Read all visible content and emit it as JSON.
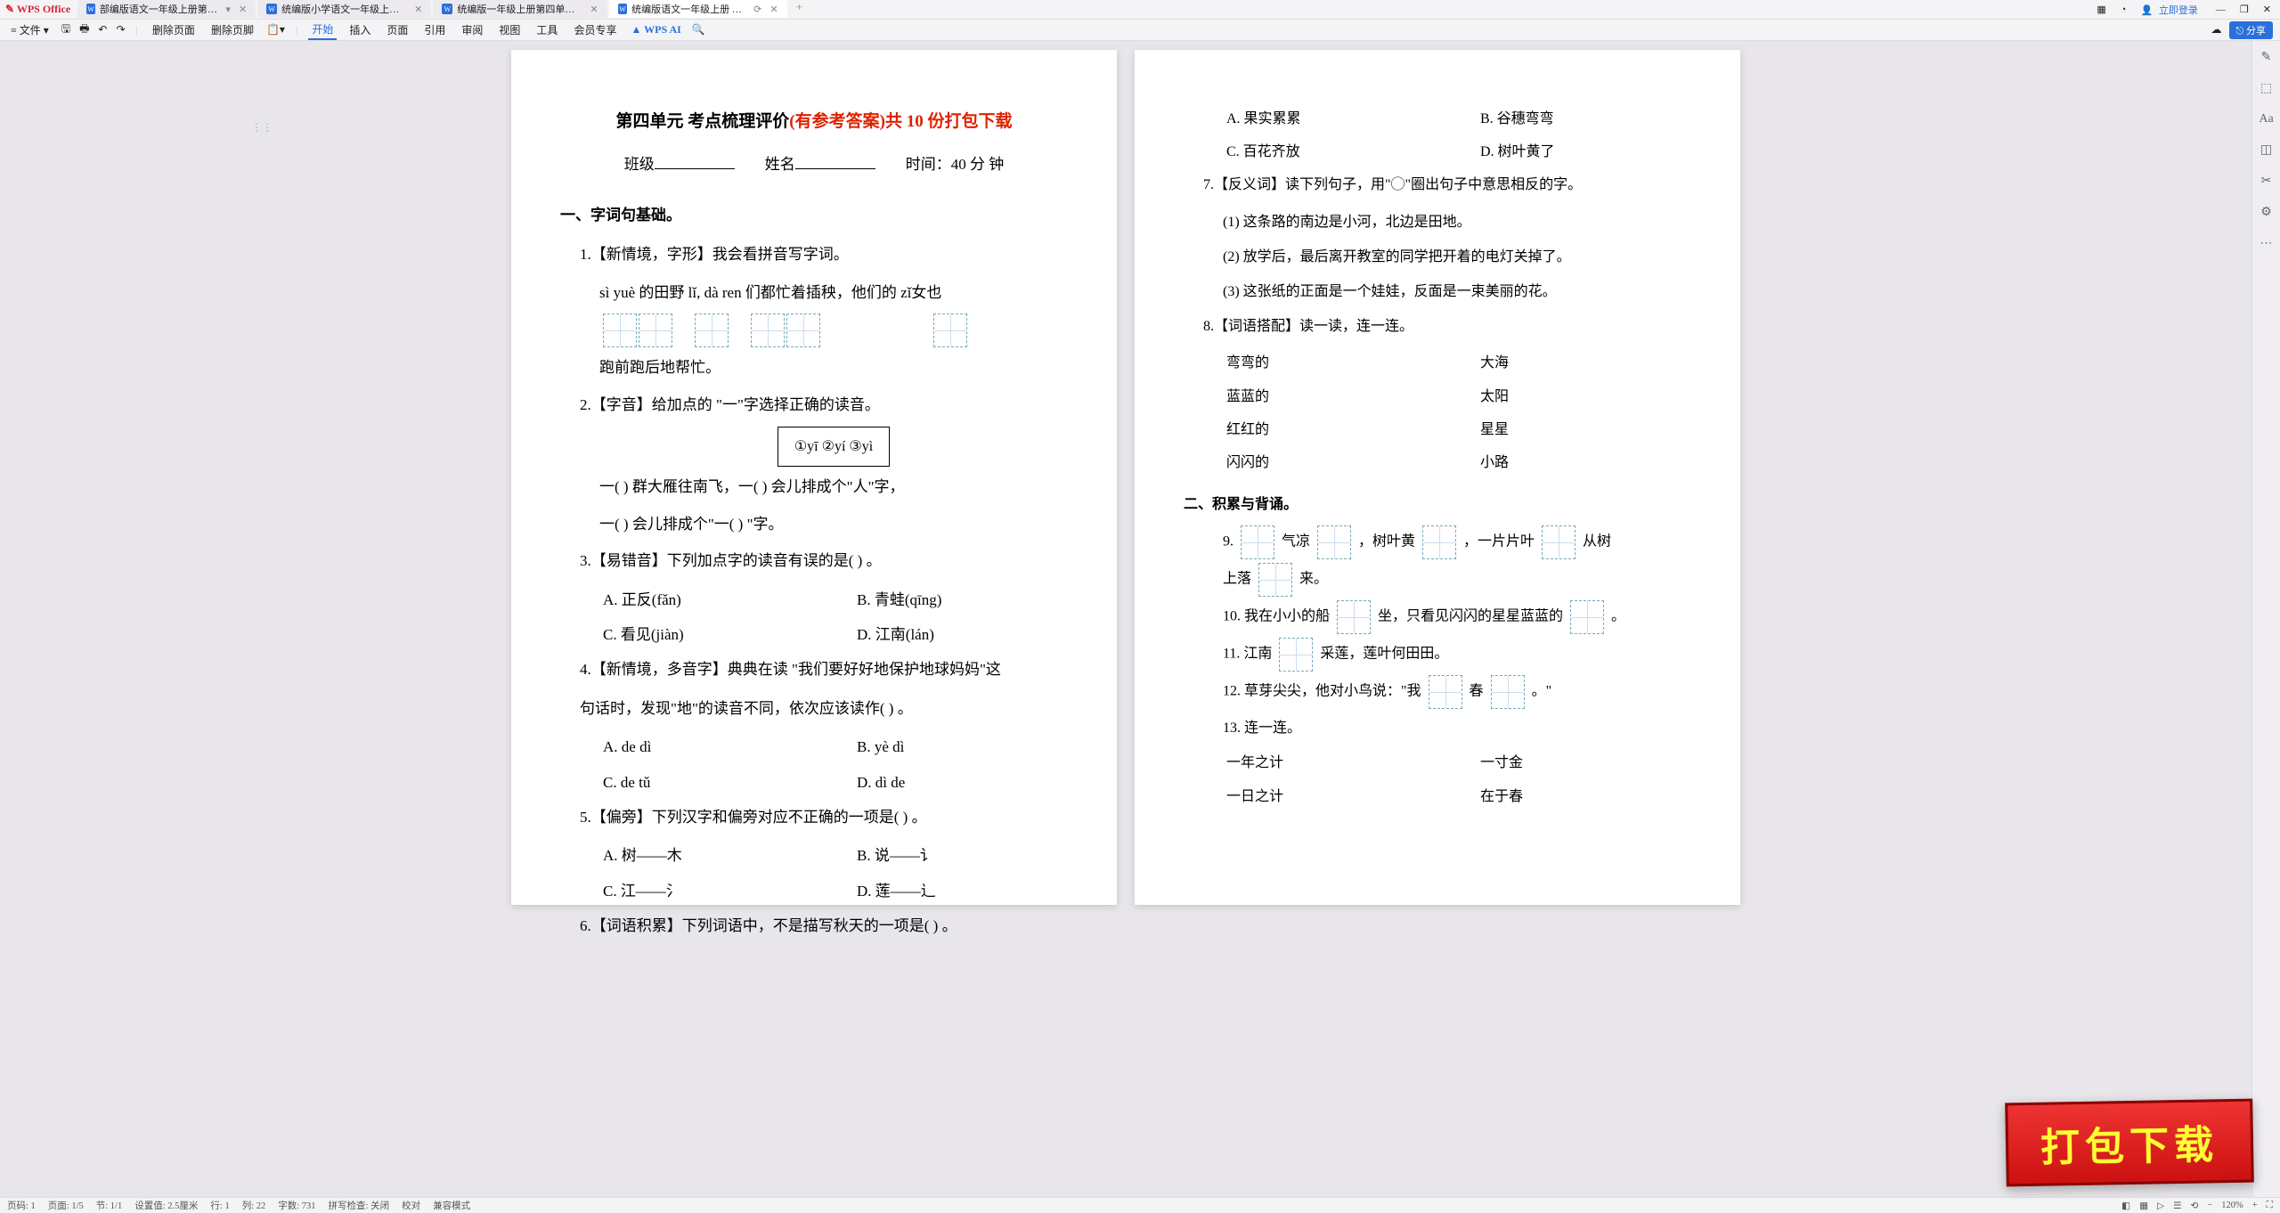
{
  "app": "WPS Office",
  "tabs": [
    {
      "label": "部编版语文一年级上册第四单元综"
    },
    {
      "label": "统编版小学语文一年级上册第四单元"
    },
    {
      "label": "统编版一年级上册第四单元试卷(含答"
    },
    {
      "label": "统编版语文一年级上册 第四年"
    }
  ],
  "window": {
    "login": "立即登录"
  },
  "toolbar": {
    "file": "文件",
    "delpage": "删除页面",
    "delpgft": "删除页脚",
    "menus": [
      "开始",
      "插入",
      "页面",
      "引用",
      "审阅",
      "视图",
      "工具",
      "会员专享"
    ],
    "ai": "WPS AI",
    "share": "分享"
  },
  "page1": {
    "title_a": "第四单元  考点梳理评价",
    "title_b": "(有参考答案)共 10 份打包下载",
    "info_class": "班级",
    "info_name": "姓名",
    "info_time": "时间：",
    "info_time_v": "40 分 钟",
    "s1": "一、字词句基础。",
    "q1": "1.【新情境，字形】我会看拼音写字词。",
    "q1_line": "sì   yuè 的田野 lǐ,     dà ren  们都忙着插秧，他们的 zǐ女也",
    "q1_tail": "跑前跑后地帮忙。",
    "q2": "2.【字音】给加点的 \"一\"字选择正确的读音。",
    "q2_box": "①yī   ②yí   ③yì",
    "q2_line1": "一(       )  群大雁往南飞，一(       )  会儿排成个\"人\"字，",
    "q2_line2": "一(       )  会儿排成个\"一(       ) \"字。",
    "q3": "3.【易错音】下列加点字的读音有误的是(       ) 。",
    "q3a": "A. 正反(fǎn)",
    "q3b": "B. 青蛙(qīng)",
    "q3c": "C. 看见(jiàn)",
    "q3d": "D. 江南(lán)",
    "q4": "4.【新情境，多音字】典典在读 \"我们要好好地保护地球妈妈\"这",
    "q4b": "句话时，发现\"地\"的读音不同，依次应该读作(       ) 。",
    "q4a1": "A. de   dì",
    "q4b1": "B. yè   dì",
    "q4c1": "C. de   tǔ",
    "q4d1": "D. dì   de",
    "q5": "5.【偏旁】下列汉字和偏旁对应不正确的一项是(       ) 。",
    "q5a": "A. 树——木",
    "q5b": "B. 说——讠",
    "q5c": "C. 江——氵",
    "q5d": "D. 莲——辶",
    "q6": "6.【词语积累】下列词语中，不是描写秋天的一项是(       ) 。"
  },
  "page2": {
    "optA": "A. 果实累累",
    "optB": "B. 谷穗弯弯",
    "optC": "C. 百花齐放",
    "optD": "D. 树叶黄了",
    "q7": "7.【反义词】读下列句子，用\"◯\"圈出句子中意思相反的字。",
    "q7_1": "(1) 这条路的南边是小河，北边是田地。",
    "q7_2": "(2) 放学后，最后离开教室的同学把开着的电灯关掉了。",
    "q7_3": "(3) 这张纸的正面是一个娃娃，反面是一束美丽的花。",
    "q8": "8.【词语搭配】读一读，连一连。",
    "q8l": [
      "弯弯的",
      "蓝蓝的",
      "红红的",
      "闪闪的"
    ],
    "q8r": [
      "大海",
      "太阳",
      "星星",
      "小路"
    ],
    "s2": "二、积累与背诵。",
    "q9a": "9.",
    "q9b": "气凉",
    "q9c": "，树叶黄",
    "q9d": "，一片片叶",
    "q9e": "从树",
    "q9f": "上落",
    "q9g": "来。",
    "q10a": "10. 我在小小的船",
    "q10b": "坐，只看见闪闪的星星蓝蓝的",
    "q10c": "。",
    "q11a": "11. 江南",
    "q11b": "采莲，莲叶何田田。",
    "q12a": "12. 草芽尖尖，他对小鸟说：\"我",
    "q12b": "春",
    "q12c": "。\"",
    "q13": "13. 连一连。",
    "q13l": [
      "一年之计",
      "一日之计"
    ],
    "q13r": [
      "一寸金",
      "在于春"
    ]
  },
  "status": {
    "page": "页码: 1",
    "pages": "页面: 1/5",
    "sec": "节: 1/1",
    "set": "设置值: 2.5厘米",
    "row": "行: 1",
    "col": "列: 22",
    "chars": "字数: 731",
    "spell": "拼写检查: 关闭",
    "proof": "校对",
    "mode": "兼容模式",
    "zoom": "120%"
  },
  "stamp": "打包下载"
}
